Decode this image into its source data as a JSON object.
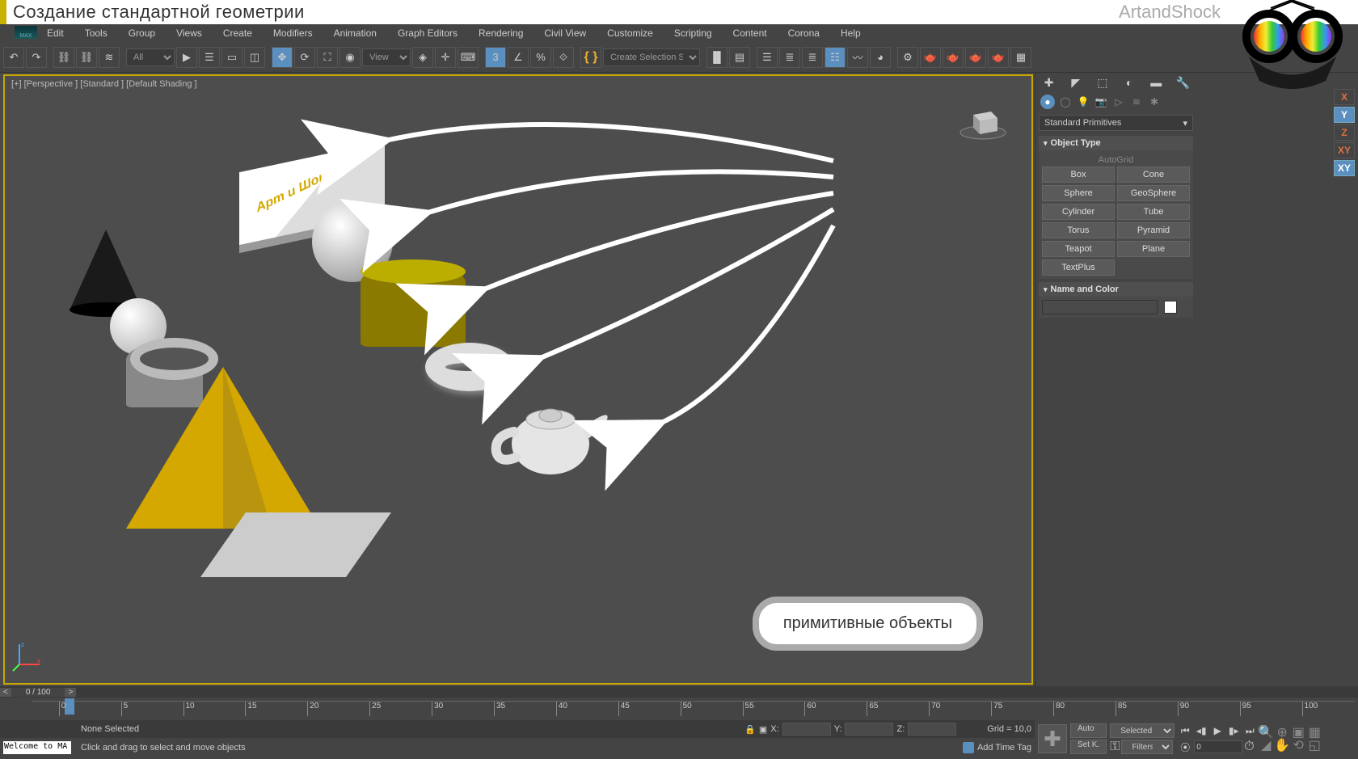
{
  "header": {
    "title": "Создание стандартной геометрии",
    "brand": "ArtandShock"
  },
  "menu": [
    "Edit",
    "Tools",
    "Group",
    "Views",
    "Create",
    "Modifiers",
    "Animation",
    "Graph Editors",
    "Rendering",
    "Civil View",
    "Customize",
    "Scripting",
    "Content",
    "Corona",
    "Help"
  ],
  "toolbar": {
    "filter": "All",
    "view": "View",
    "selset": "Create Selection Set"
  },
  "viewport": {
    "label": "[+] [Perspective ] [Standard ] [Default Shading ]",
    "box_text": "Арт и Шок",
    "annotation": "примитивные объекты"
  },
  "create_panel": {
    "dropdown": "Standard Primitives",
    "rollout1": "Object Type",
    "autogrid": "AutoGrid",
    "primitives": [
      "Box",
      "Cone",
      "Sphere",
      "GeoSphere",
      "Cylinder",
      "Tube",
      "Torus",
      "Pyramid",
      "Teapot",
      "Plane",
      "TextPlus"
    ],
    "rollout2": "Name and Color"
  },
  "axes": [
    "X",
    "Y",
    "Z",
    "XY",
    "XY"
  ],
  "timeline": {
    "counter": "0 / 100",
    "marks": [
      0,
      5,
      10,
      15,
      20,
      25,
      30,
      35,
      40,
      45,
      50,
      55,
      60,
      65,
      70,
      75,
      80,
      85,
      90,
      95,
      100
    ]
  },
  "status": {
    "none_selected": "None Selected",
    "x": "X:",
    "y": "Y:",
    "z": "Z:",
    "grid": "Grid = 10,0",
    "welcome": "Welcome to MA",
    "hint": "Click and drag to select and move objects",
    "time_tag": "Add Time Tag",
    "auto": "Auto",
    "setk": "Set K.",
    "selected": "Selected",
    "filters": "Filters...",
    "frame": "0"
  }
}
